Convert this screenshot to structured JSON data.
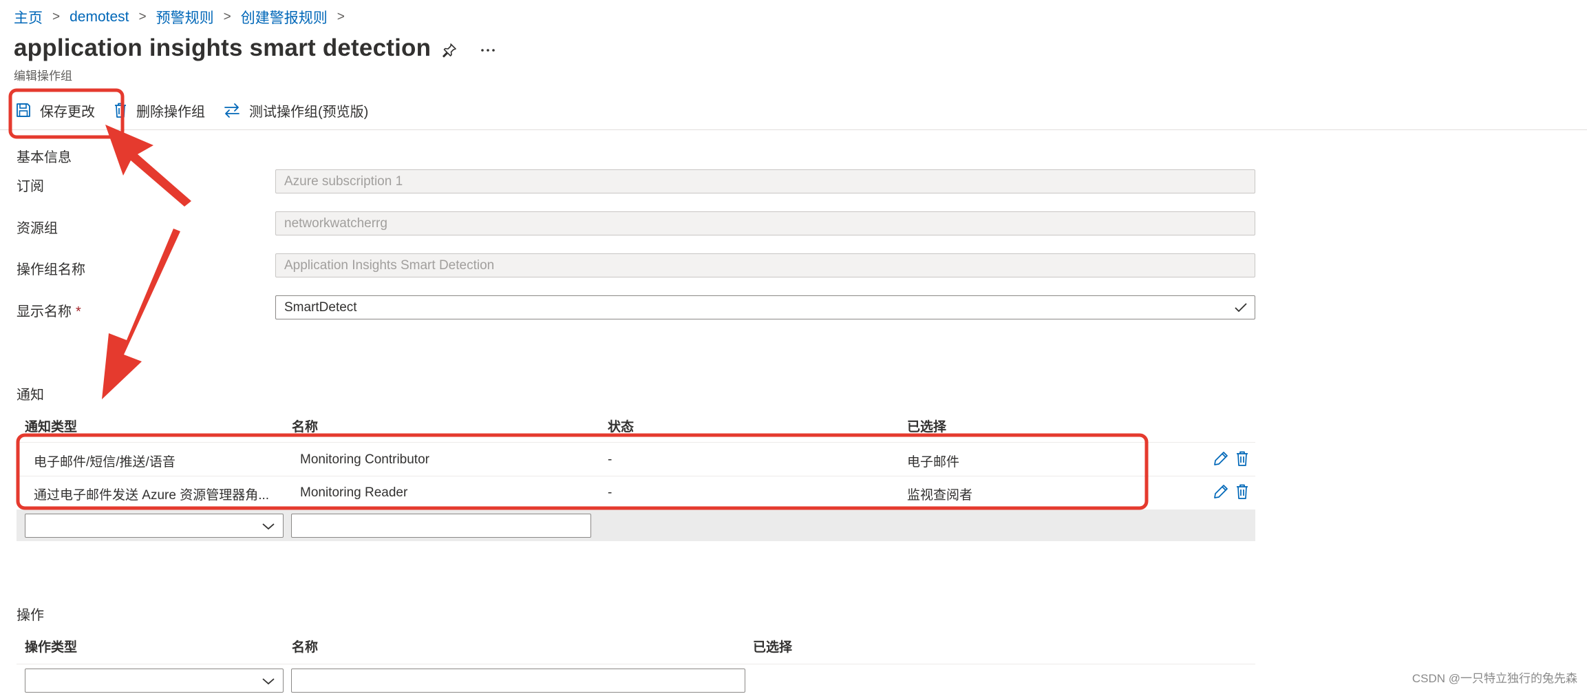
{
  "breadcrumb": {
    "items": [
      "主页",
      "demotest",
      "预警规则",
      "创建警报规则"
    ],
    "separator": ">"
  },
  "header": {
    "title": "application insights smart detection",
    "subtitle": "编辑操作组",
    "icons": [
      "pin-icon",
      "more-icon"
    ]
  },
  "toolbar": {
    "save_label": "保存更改",
    "delete_label": "删除操作组",
    "test_label": "测试操作组(预览版)"
  },
  "basics": {
    "section_title": "基本信息",
    "subscription": {
      "label": "订阅",
      "value": "Azure subscription 1"
    },
    "resource_group": {
      "label": "资源组",
      "value": "networkwatcherrg"
    },
    "action_group_name": {
      "label": "操作组名称",
      "value": "Application Insights Smart Detection"
    },
    "display_name": {
      "label": "显示名称",
      "required_mark": "*",
      "value": "SmartDetect"
    }
  },
  "notifications": {
    "section_title": "通知",
    "columns": [
      "通知类型",
      "名称",
      "状态",
      "已选择"
    ],
    "rows": [
      {
        "type": "电子邮件/短信/推送/语音",
        "name": "Monitoring Contributor",
        "status": "-",
        "selected": "电子邮件"
      },
      {
        "type": "通过电子邮件发送 Azure 资源管理器角...",
        "name": "Monitoring Reader",
        "status": "-",
        "selected": "监视查阅者"
      }
    ],
    "new_row": {
      "type_value": "",
      "name_value": ""
    }
  },
  "actions": {
    "section_title": "操作",
    "columns": [
      "操作类型",
      "名称",
      "已选择"
    ],
    "new_row": {
      "type_value": "",
      "name_value": ""
    }
  },
  "watermark": "CSDN @一只特立独行的兔先森",
  "colors": {
    "link": "#0067b8",
    "annotation": "#e53a2e",
    "disabled_bg": "#f3f2f1",
    "add_row_bg": "#ebebeb",
    "required": "#a4262c"
  }
}
